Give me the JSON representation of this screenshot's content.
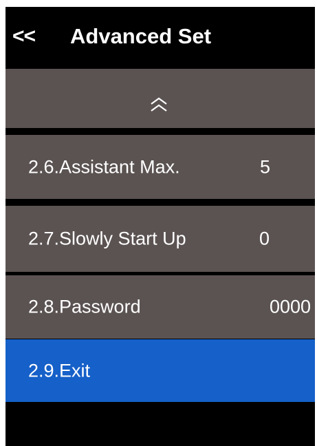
{
  "header": {
    "back_label": "<<",
    "title": "Advanced Set"
  },
  "menu": {
    "scroll_up_icon": "double-chevron-up",
    "items": [
      {
        "label": "2.6.Assistant Max.",
        "value": "5"
      },
      {
        "label": "2.7.Slowly Start Up",
        "value": "0"
      },
      {
        "label": "2.8.Password",
        "value": "0000"
      },
      {
        "label": "2.9.Exit",
        "value": ""
      }
    ],
    "selected_index": 3
  },
  "colors": {
    "background": "#000000",
    "item_background": "#5b5352",
    "selected_background": "#1560c9",
    "text": "#ffffff"
  }
}
